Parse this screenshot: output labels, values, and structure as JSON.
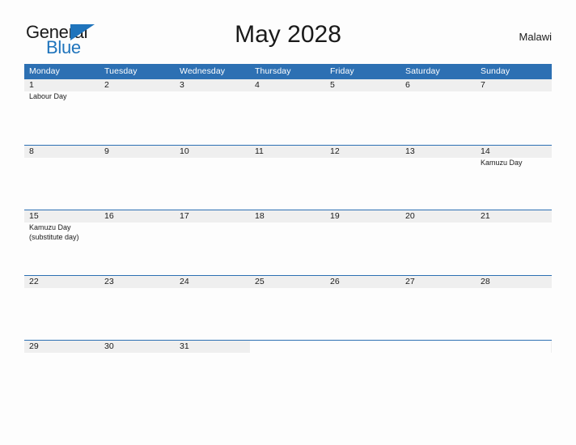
{
  "brand": {
    "word_one": "General",
    "word_two": "Blue",
    "flag_icon": "triangle-flag-icon",
    "color_primary": "#1f74bc",
    "color_text": "#1a1a1a"
  },
  "header": {
    "title": "May 2028",
    "country": "Malawi"
  },
  "calendar": {
    "header_bg": "#2d70b3",
    "band_bg": "#efefef",
    "weekdays": [
      "Monday",
      "Tuesday",
      "Wednesday",
      "Thursday",
      "Friday",
      "Saturday",
      "Sunday"
    ],
    "weeks": [
      {
        "days": [
          {
            "date": "1",
            "events": [
              "Labour Day"
            ]
          },
          {
            "date": "2",
            "events": []
          },
          {
            "date": "3",
            "events": []
          },
          {
            "date": "4",
            "events": []
          },
          {
            "date": "5",
            "events": []
          },
          {
            "date": "6",
            "events": []
          },
          {
            "date": "7",
            "events": []
          }
        ]
      },
      {
        "days": [
          {
            "date": "8",
            "events": []
          },
          {
            "date": "9",
            "events": []
          },
          {
            "date": "10",
            "events": []
          },
          {
            "date": "11",
            "events": []
          },
          {
            "date": "12",
            "events": []
          },
          {
            "date": "13",
            "events": []
          },
          {
            "date": "14",
            "events": [
              "Kamuzu Day"
            ]
          }
        ]
      },
      {
        "days": [
          {
            "date": "15",
            "events": [
              "Kamuzu Day",
              "(substitute day)"
            ]
          },
          {
            "date": "16",
            "events": []
          },
          {
            "date": "17",
            "events": []
          },
          {
            "date": "18",
            "events": []
          },
          {
            "date": "19",
            "events": []
          },
          {
            "date": "20",
            "events": []
          },
          {
            "date": "21",
            "events": []
          }
        ]
      },
      {
        "days": [
          {
            "date": "22",
            "events": []
          },
          {
            "date": "23",
            "events": []
          },
          {
            "date": "24",
            "events": []
          },
          {
            "date": "25",
            "events": []
          },
          {
            "date": "26",
            "events": []
          },
          {
            "date": "27",
            "events": []
          },
          {
            "date": "28",
            "events": []
          }
        ]
      },
      {
        "days": [
          {
            "date": "29",
            "events": []
          },
          {
            "date": "30",
            "events": []
          },
          {
            "date": "31",
            "events": []
          },
          {
            "date": "",
            "events": []
          },
          {
            "date": "",
            "events": []
          },
          {
            "date": "",
            "events": []
          },
          {
            "date": "",
            "events": []
          }
        ]
      }
    ]
  }
}
